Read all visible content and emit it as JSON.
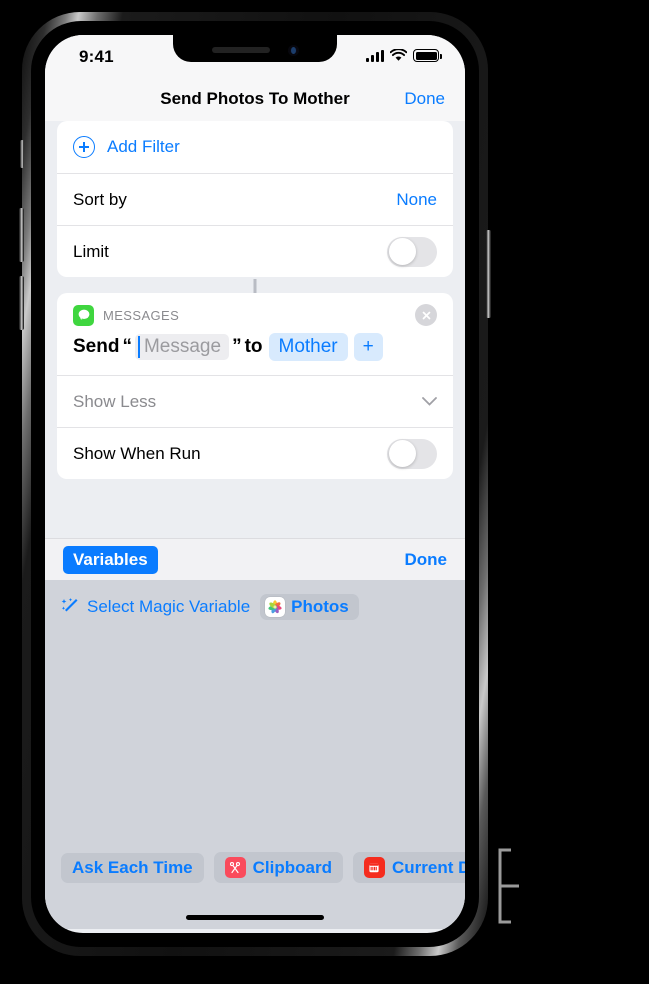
{
  "status_bar": {
    "time": "9:41",
    "signal_icon": "cellular-bars-icon",
    "wifi_icon": "wifi-icon",
    "battery_icon": "battery-full-icon"
  },
  "nav_bar": {
    "title": "Send Photos To Mother",
    "done_label": "Done"
  },
  "filter_card": {
    "add_filter_label": "Add Filter",
    "add_filter_icon": "plus-circle-icon",
    "sort_by_label": "Sort by",
    "sort_by_value": "None",
    "limit_label": "Limit",
    "limit_toggle_state": "off"
  },
  "messages_card": {
    "app_icon": "messages-app-icon",
    "app_name": "MESSAGES",
    "close_icon": "close-circle-icon",
    "send_word": "Send",
    "open_quote": "“",
    "message_placeholder": "Message",
    "close_quote": "”",
    "to_word": "to",
    "recipient_chip": "Mother",
    "add_recipient_chip": "+",
    "show_less_label": "Show Less",
    "show_less_icon": "chevron-down-icon",
    "show_when_run_label": "Show When Run",
    "show_when_run_toggle_state": "off"
  },
  "variables_panel": {
    "variables_button_label": "Variables",
    "done_label": "Done",
    "magic_variable_icon": "magic-wand-icon",
    "magic_variable_label": "Select Magic Variable",
    "photos_chip": {
      "icon": "photos-app-icon",
      "label": "Photos"
    },
    "toolbar_chips": [
      {
        "label": "Ask Each Time",
        "icon": ""
      },
      {
        "label": "Clipboard",
        "icon": "scissors-icon"
      },
      {
        "label": "Current D",
        "icon": "calendar-icon"
      }
    ]
  },
  "colors": {
    "accent_blue": "#0a7cff",
    "chip_blue_bg": "#d8eafd",
    "panel_gray": "#d0d3da",
    "messages_green": "#3fd63f",
    "clipboard_red": "#fa4b5c",
    "calendar_red": "#f52c1e"
  }
}
